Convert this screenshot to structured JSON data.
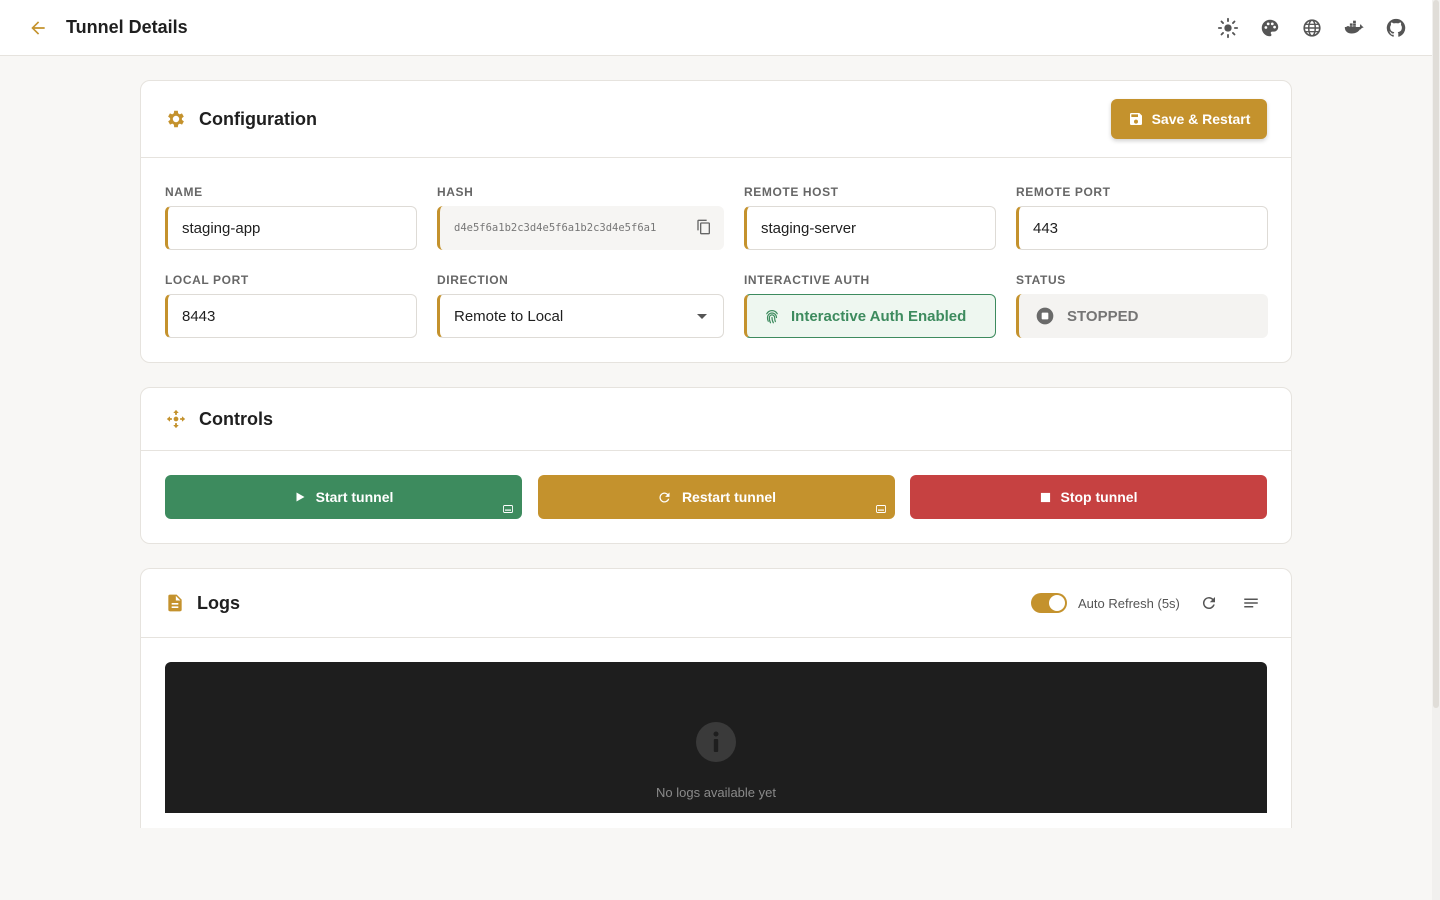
{
  "header": {
    "title": "Tunnel Details",
    "icons": [
      "arrow-left-icon",
      "sun-icon",
      "palette-icon",
      "globe-icon",
      "docker-icon",
      "github-icon"
    ]
  },
  "colors": {
    "accent": "#c4922d",
    "success": "#3d8b5e",
    "danger": "#c64141",
    "logs_bg": "#1e1e1e"
  },
  "configuration": {
    "title": "Configuration",
    "save_label": "Save & Restart",
    "fields": {
      "name": {
        "label": "NAME",
        "value": "staging-app"
      },
      "hash": {
        "label": "HASH",
        "value": "d4e5f6a1b2c3d4e5f6a1b2c3d4e5f6a1"
      },
      "remote_host": {
        "label": "REMOTE HOST",
        "value": "staging-server"
      },
      "remote_port": {
        "label": "REMOTE PORT",
        "value": "443"
      },
      "local_port": {
        "label": "LOCAL PORT",
        "value": "8443"
      },
      "direction": {
        "label": "DIRECTION",
        "value": "Remote to Local"
      },
      "interactive_auth": {
        "label": "INTERACTIVE AUTH",
        "value": "Interactive Auth Enabled"
      },
      "status": {
        "label": "STATUS",
        "value": "STOPPED"
      }
    }
  },
  "controls": {
    "title": "Controls",
    "start_label": "Start tunnel",
    "restart_label": "Restart tunnel",
    "stop_label": "Stop tunnel"
  },
  "logs": {
    "title": "Logs",
    "auto_refresh_label": "Auto Refresh (5s)",
    "auto_refresh_on": true,
    "empty_text": "No logs available yet"
  }
}
